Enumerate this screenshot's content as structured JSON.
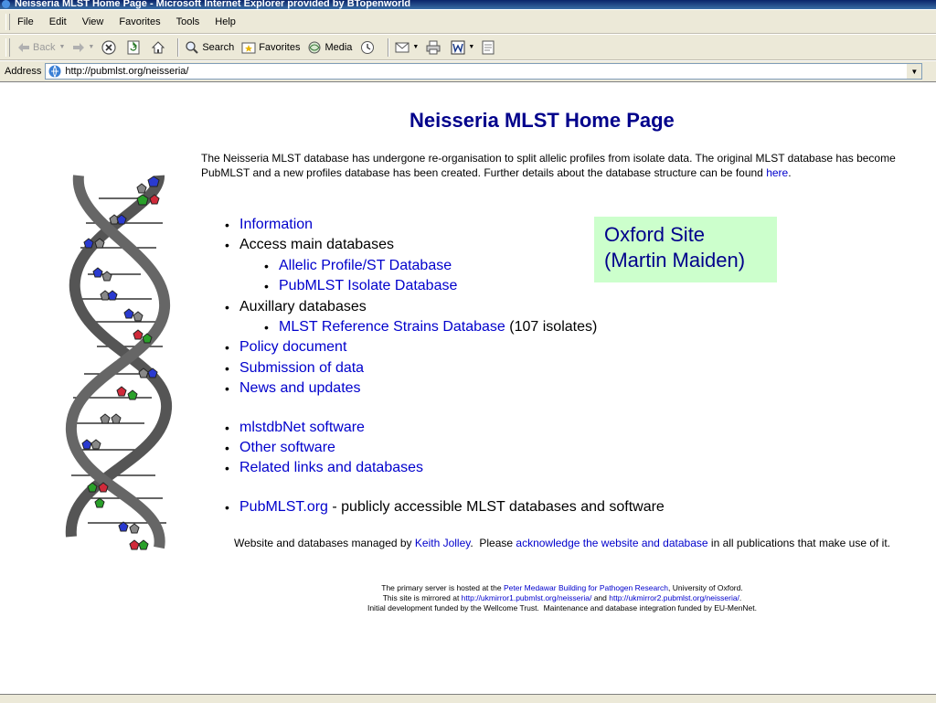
{
  "window": {
    "title": "Neisseria MLST Home Page - Microsoft Internet Explorer provided by BTopenworld"
  },
  "menubar": [
    "File",
    "Edit",
    "View",
    "Favorites",
    "Tools",
    "Help"
  ],
  "toolbar": {
    "back": "Back",
    "search": "Search",
    "favorites": "Favorites",
    "media": "Media"
  },
  "address": {
    "label": "Address",
    "url": "http://pubmlst.org/neisseria/"
  },
  "page": {
    "heading": "Neisseria MLST Home Page",
    "intro": "The Neisseria MLST database has undergone re-organisation to split allelic profiles from isolate data. The original MLST database has become PubMLST and a new profiles database has been created. Further details about the database structure can be found ",
    "intro_link": "here",
    "intro_end": ".",
    "menu": {
      "information": "Information",
      "access_main": "Access main databases",
      "allelic": "Allelic Profile/ST Database",
      "isolate": "PubMLST Isolate Database",
      "auxillary": "Auxillary databases",
      "reference": "MLST Reference Strains Database",
      "reference_count": " (107 isolates)",
      "policy": "Policy document",
      "submission": "Submission of data",
      "news": "News and updates",
      "mlstdbnet": "mlstdbNet software",
      "other_software": "Other software",
      "related": "Related links and databases",
      "pubmlst": "PubMLST.org",
      "pubmlst_desc": " - publicly accessible MLST databases and software"
    },
    "oxford_line1": "Oxford Site",
    "oxford_line2": "(Martin Maiden)",
    "managed_pre": "Website and databases managed by ",
    "managed_person": "Keith Jolley",
    "managed_mid": ".  Please ",
    "managed_ack": "acknowledge the website and database",
    "managed_post": " in all publications that make use of it.",
    "fine1_pre": "The primary server is hosted at the ",
    "fine1_link": "Peter Medawar Building for Pathogen Research",
    "fine1_post": ", University of Oxford.",
    "fine2_pre": "This site is mirrored at ",
    "fine2_link1": "http://ukmirror1.pubmlst.org/neisseria/",
    "fine2_mid": " and ",
    "fine2_link2": "http://ukmirror2.pubmlst.org/neisseria/",
    "fine2_post": ".",
    "fine3": "Initial development funded by the Wellcome Trust.  Maintenance and database integration funded by EU-MenNet."
  }
}
